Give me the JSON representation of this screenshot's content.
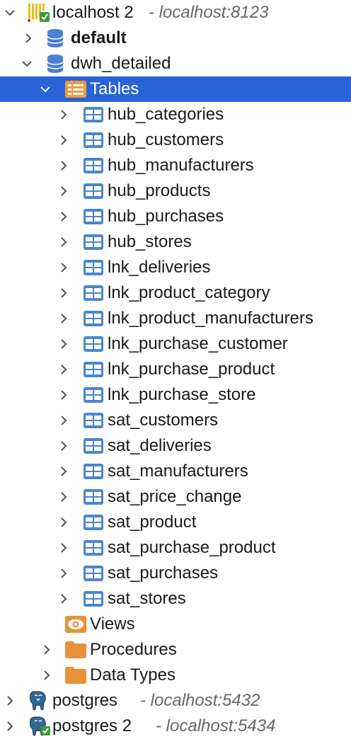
{
  "tree": {
    "connection_clickhouse": {
      "label": "localhost 2",
      "host": "- localhost:8123"
    },
    "db_default": {
      "label": "default"
    },
    "db_dwh": {
      "label": "dwh_detailed"
    },
    "folder_tables": {
      "label": "Tables"
    },
    "tables": [
      "hub_categories",
      "hub_customers",
      "hub_manufacturers",
      "hub_products",
      "hub_purchases",
      "hub_stores",
      "lnk_deliveries",
      "lnk_product_category",
      "lnk_product_manufacturers",
      "lnk_purchase_customer",
      "lnk_purchase_product",
      "lnk_purchase_store",
      "sat_customers",
      "sat_deliveries",
      "sat_manufacturers",
      "sat_price_change",
      "sat_product",
      "sat_purchase_product",
      "sat_purchases",
      "sat_stores"
    ],
    "folder_views": {
      "label": "Views"
    },
    "folder_procedures": {
      "label": "Procedures"
    },
    "folder_datatypes": {
      "label": "Data Types"
    },
    "connection_postgres": {
      "label": "postgres",
      "host": "- localhost:5432"
    },
    "connection_postgres2": {
      "label": "postgres 2",
      "host": "- localhost:5434"
    }
  },
  "colors": {
    "selection": "#2a63d8",
    "db_icon": "#4a7fd4",
    "table_icon": "#4a86d0",
    "folder_icon": "#e8923a"
  }
}
